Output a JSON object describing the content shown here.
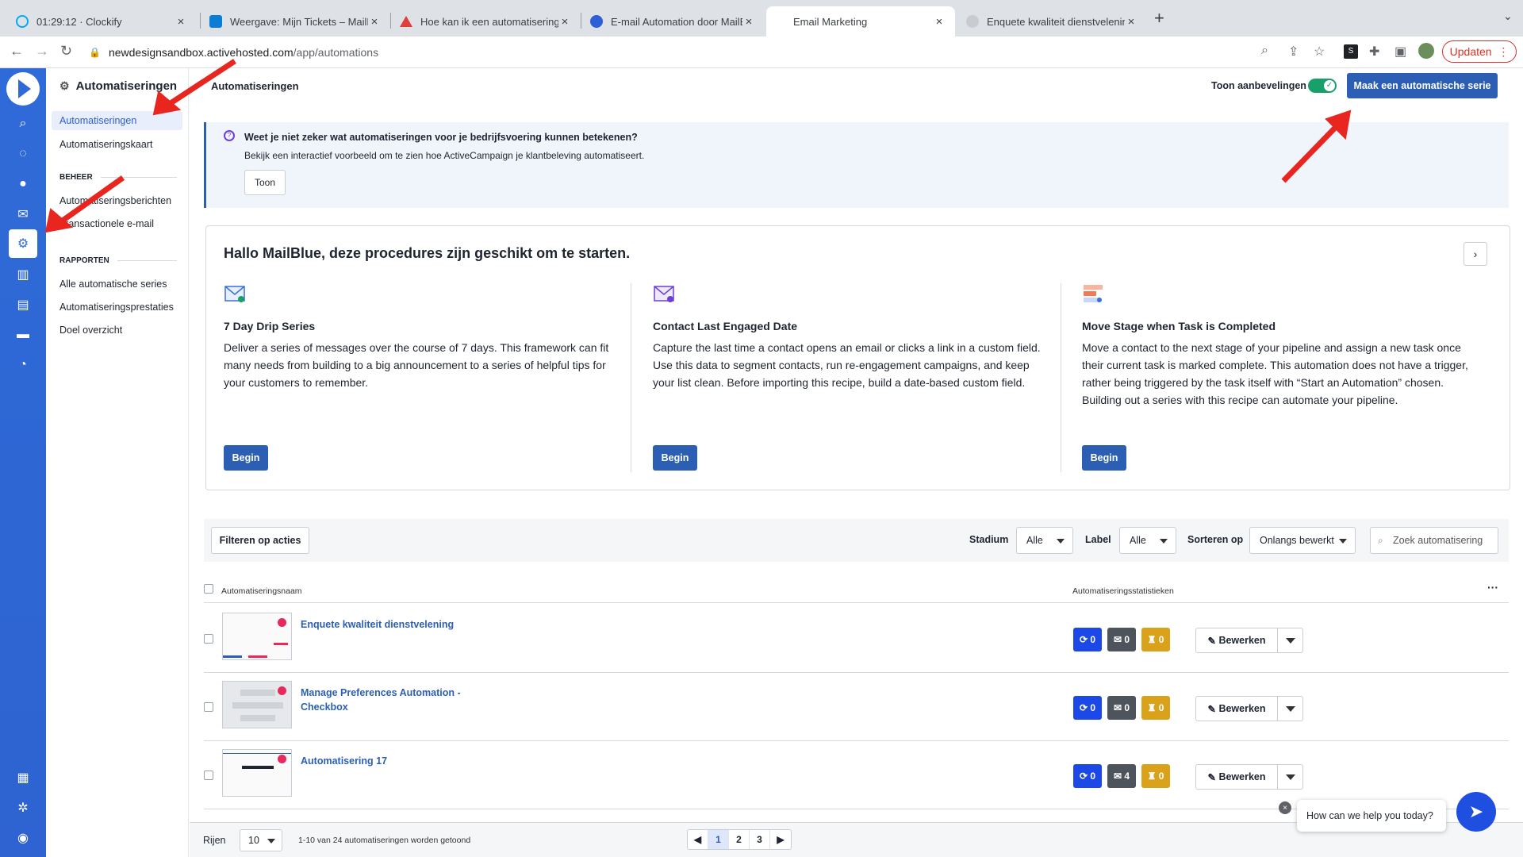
{
  "browser": {
    "tabs": [
      {
        "title": "01:29:12 · Clockify",
        "favicon_color": "#03a9f4"
      },
      {
        "title": "Weergave: Mijn Tickets – MailB",
        "favicon_color": "#0a7ed6"
      },
      {
        "title": "Hoe kan ik een automatisering",
        "favicon_color": "#e03e3e"
      },
      {
        "title": "E-mail Automation door MailBl",
        "favicon_color": "#2d5fd6"
      },
      {
        "title": "Email Marketing",
        "favicon_color": ""
      },
      {
        "title": "Enquete kwaliteit dienstvelenin",
        "favicon_color": "#c8cbd0"
      }
    ],
    "url_host": "newdesignsandbox.activehosted.com",
    "url_path": "/app/automations",
    "update_label": "Updaten"
  },
  "subnav": {
    "title": "Automatiseringen",
    "items_top": [
      "Automatiseringen",
      "Automatiseringskaart"
    ],
    "section_beheer": "BEHEER",
    "items_beheer": [
      "Automatiseringsberichten",
      "Transactionele e-mail"
    ],
    "section_rapporten": "RAPPORTEN",
    "items_rapporten": [
      "Alle automatische series",
      "Automatiseringsprestaties",
      "Doel overzicht"
    ]
  },
  "header": {
    "title": "Automatiseringen",
    "toggle_label": "Toon aanbevelingen",
    "primary_button": "Maak een automatische serie"
  },
  "banner": {
    "title": "Weet je niet zeker wat automatiseringen voor je bedrijfsvoering kunnen betekenen?",
    "text": "Bekijk een interactief voorbeeld om te zien hoe ActiveCampaign je klantbeleving automatiseert.",
    "button": "Toon"
  },
  "recipes": {
    "title": "Hallo MailBlue, deze procedures zijn geschikt om te starten.",
    "cards": [
      {
        "name": "7 Day Drip Series",
        "description": "Deliver a series of messages over the course of 7 days. This framework can fit many needs from building to a big announcement to a series of helpful tips for your customers to remember.",
        "button": "Begin"
      },
      {
        "name": "Contact Last Engaged Date",
        "description": "Capture the last time a contact opens an email or clicks a link in a custom field. Use this data to segment contacts, run re-engagement campaigns, and keep your list clean. Before importing this recipe, build a date-based custom field.",
        "button": "Begin"
      },
      {
        "name": "Move Stage when Task is Completed",
        "description": "Move a contact to the next stage of your pipeline and assign a new task once their current task is marked complete. This automation does not have a trigger, rather being triggered by the task itself with “Start an Automation” chosen. Building out a series with this recipe can automate your pipeline.",
        "button": "Begin"
      }
    ]
  },
  "filters": {
    "filter_button": "Filteren op acties",
    "stage_label": "Stadium",
    "stage_value": "Alle",
    "label_label": "Label",
    "label_value": "Alle",
    "sort_label": "Sorteren op",
    "sort_value": "Onlangs bewerkt",
    "search_placeholder": "Zoek automatisering"
  },
  "table": {
    "col_name": "Automatiseringsnaam",
    "col_stats": "Automatiseringsstatistieken",
    "more": "···",
    "edit_label": "Bewerken",
    "rows": [
      {
        "name": "Enquete kwaliteit dienstvelening",
        "contacts": "0",
        "emails": "0",
        "goals": "0"
      },
      {
        "name": "Manage Preferences Automation - Checkbox",
        "contacts": "0",
        "emails": "0",
        "goals": "0"
      },
      {
        "name": "Automatisering 17",
        "contacts": "0",
        "emails": "4",
        "goals": "0"
      }
    ]
  },
  "footer": {
    "rows_label": "Rijen",
    "rows_value": "10",
    "info": "1-10 van 24 automatiseringen worden getoond",
    "pages": [
      "1",
      "2",
      "3"
    ]
  },
  "chat": {
    "prompt": "How can we help you today?"
  },
  "colors": {
    "rail": "#2f6bd8",
    "primary": "#2c5fb3",
    "annotation_arrow": "#e8261f"
  }
}
